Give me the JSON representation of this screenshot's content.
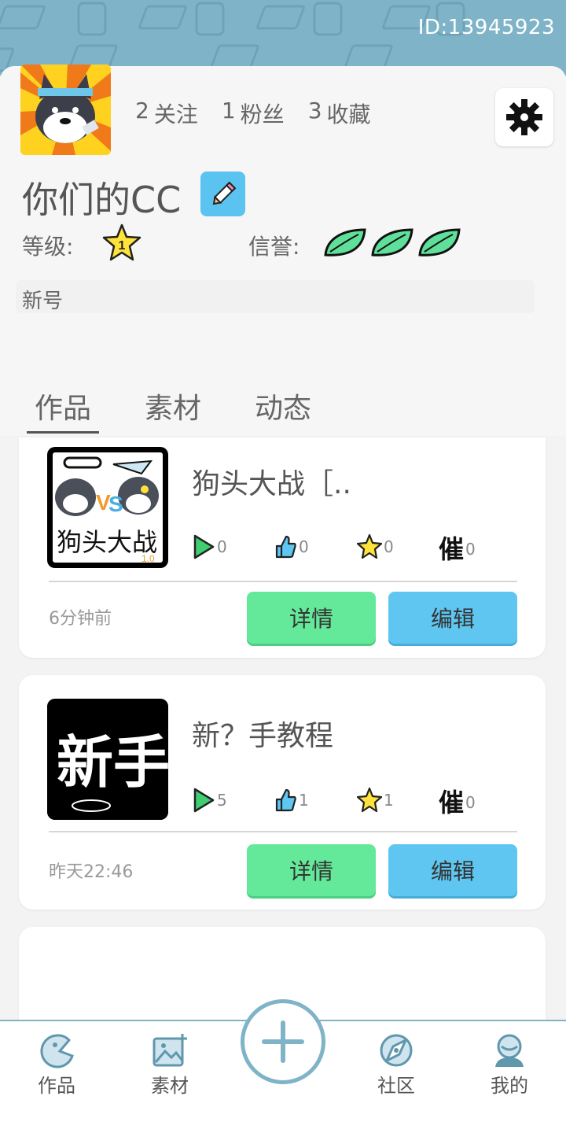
{
  "header": {
    "user_id": "ID:13945923"
  },
  "profile": {
    "following_count": "2",
    "following_label": "关注",
    "fans_count": "1",
    "fans_label": "粉丝",
    "favorites_count": "3",
    "favorites_label": "收藏",
    "username": "你们的CC",
    "level_label": "等级:",
    "level_value": "1",
    "reputation_label": "信誉:",
    "reputation_leaves": 3,
    "bio": "新号"
  },
  "tabs": [
    {
      "label": "作品",
      "active": true
    },
    {
      "label": "素材",
      "active": false
    },
    {
      "label": "动态",
      "active": false
    }
  ],
  "works": [
    {
      "title": "狗头大战［..",
      "thumb_text": "狗头大战",
      "thumb_version": "1.0",
      "plays": "0",
      "likes": "0",
      "stars": "0",
      "urges": "0",
      "urge_label": "催",
      "time": "6分钟前",
      "detail_label": "详情",
      "edit_label": "编辑"
    },
    {
      "title": "新？手教程",
      "thumb_text": "新手",
      "plays": "5",
      "likes": "1",
      "stars": "1",
      "urges": "0",
      "urge_label": "催",
      "time": "昨天22:46",
      "detail_label": "详情",
      "edit_label": "编辑"
    }
  ],
  "bottom_nav": {
    "works": "作品",
    "materials": "素材",
    "community": "社区",
    "mine": "我的"
  },
  "colors": {
    "header": "#7fb3c8",
    "detail_button": "#64e99a",
    "edit_button": "#5ec6f1"
  }
}
